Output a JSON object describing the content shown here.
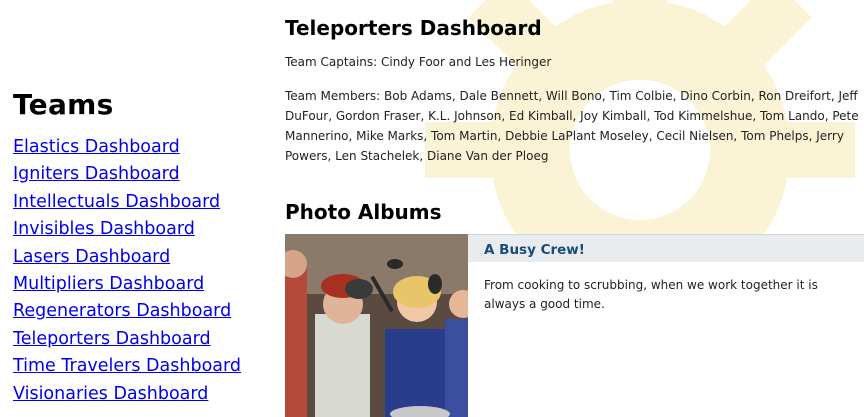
{
  "sidebar": {
    "title": "Teams",
    "teams": [
      {
        "label": "Elastics Dashboard"
      },
      {
        "label": "Igniters Dashboard"
      },
      {
        "label": "Intellectuals Dashboard"
      },
      {
        "label": "Invisibles Dashboard"
      },
      {
        "label": "Lasers Dashboard"
      },
      {
        "label": "Multipliers Dashboard"
      },
      {
        "label": "Regenerators Dashboard"
      },
      {
        "label": "Teleporters Dashboard"
      },
      {
        "label": "Time Travelers Dashboard"
      },
      {
        "label": "Visionaries Dashboard"
      }
    ]
  },
  "main": {
    "title": "Teleporters Dashboard",
    "captains": "Team Captains: Cindy Foor and Les Heringer",
    "members": "Team Members: Bob Adams, Dale Bennett, Will Bono, Tim Colbie, Dino Corbin, Ron Dreifort, Jeff DuFour, Gordon Fraser, K.L. Johnson, Ed Kimball, Joy Kimball, Tod Kimmelshue, Tom Lando, Pete Mannerino, Mike Marks, Tom Martin, Debbie LaPlant Moseley, Cecil Nielsen, Tom Phelps, Jerry Powers, Len Stachelek, Diane Van der Ploeg",
    "albums_title": "Photo Albums",
    "albums": [
      {
        "title": "A Busy Crew!",
        "description": "From cooking to scrubbing, when we work together it is always a good time."
      }
    ]
  },
  "colors": {
    "link": "#0000ee",
    "background_pattern": "#fbf3d5",
    "album_heading_bg": "#e8ecee",
    "album_heading_text": "#1a4a7a"
  }
}
